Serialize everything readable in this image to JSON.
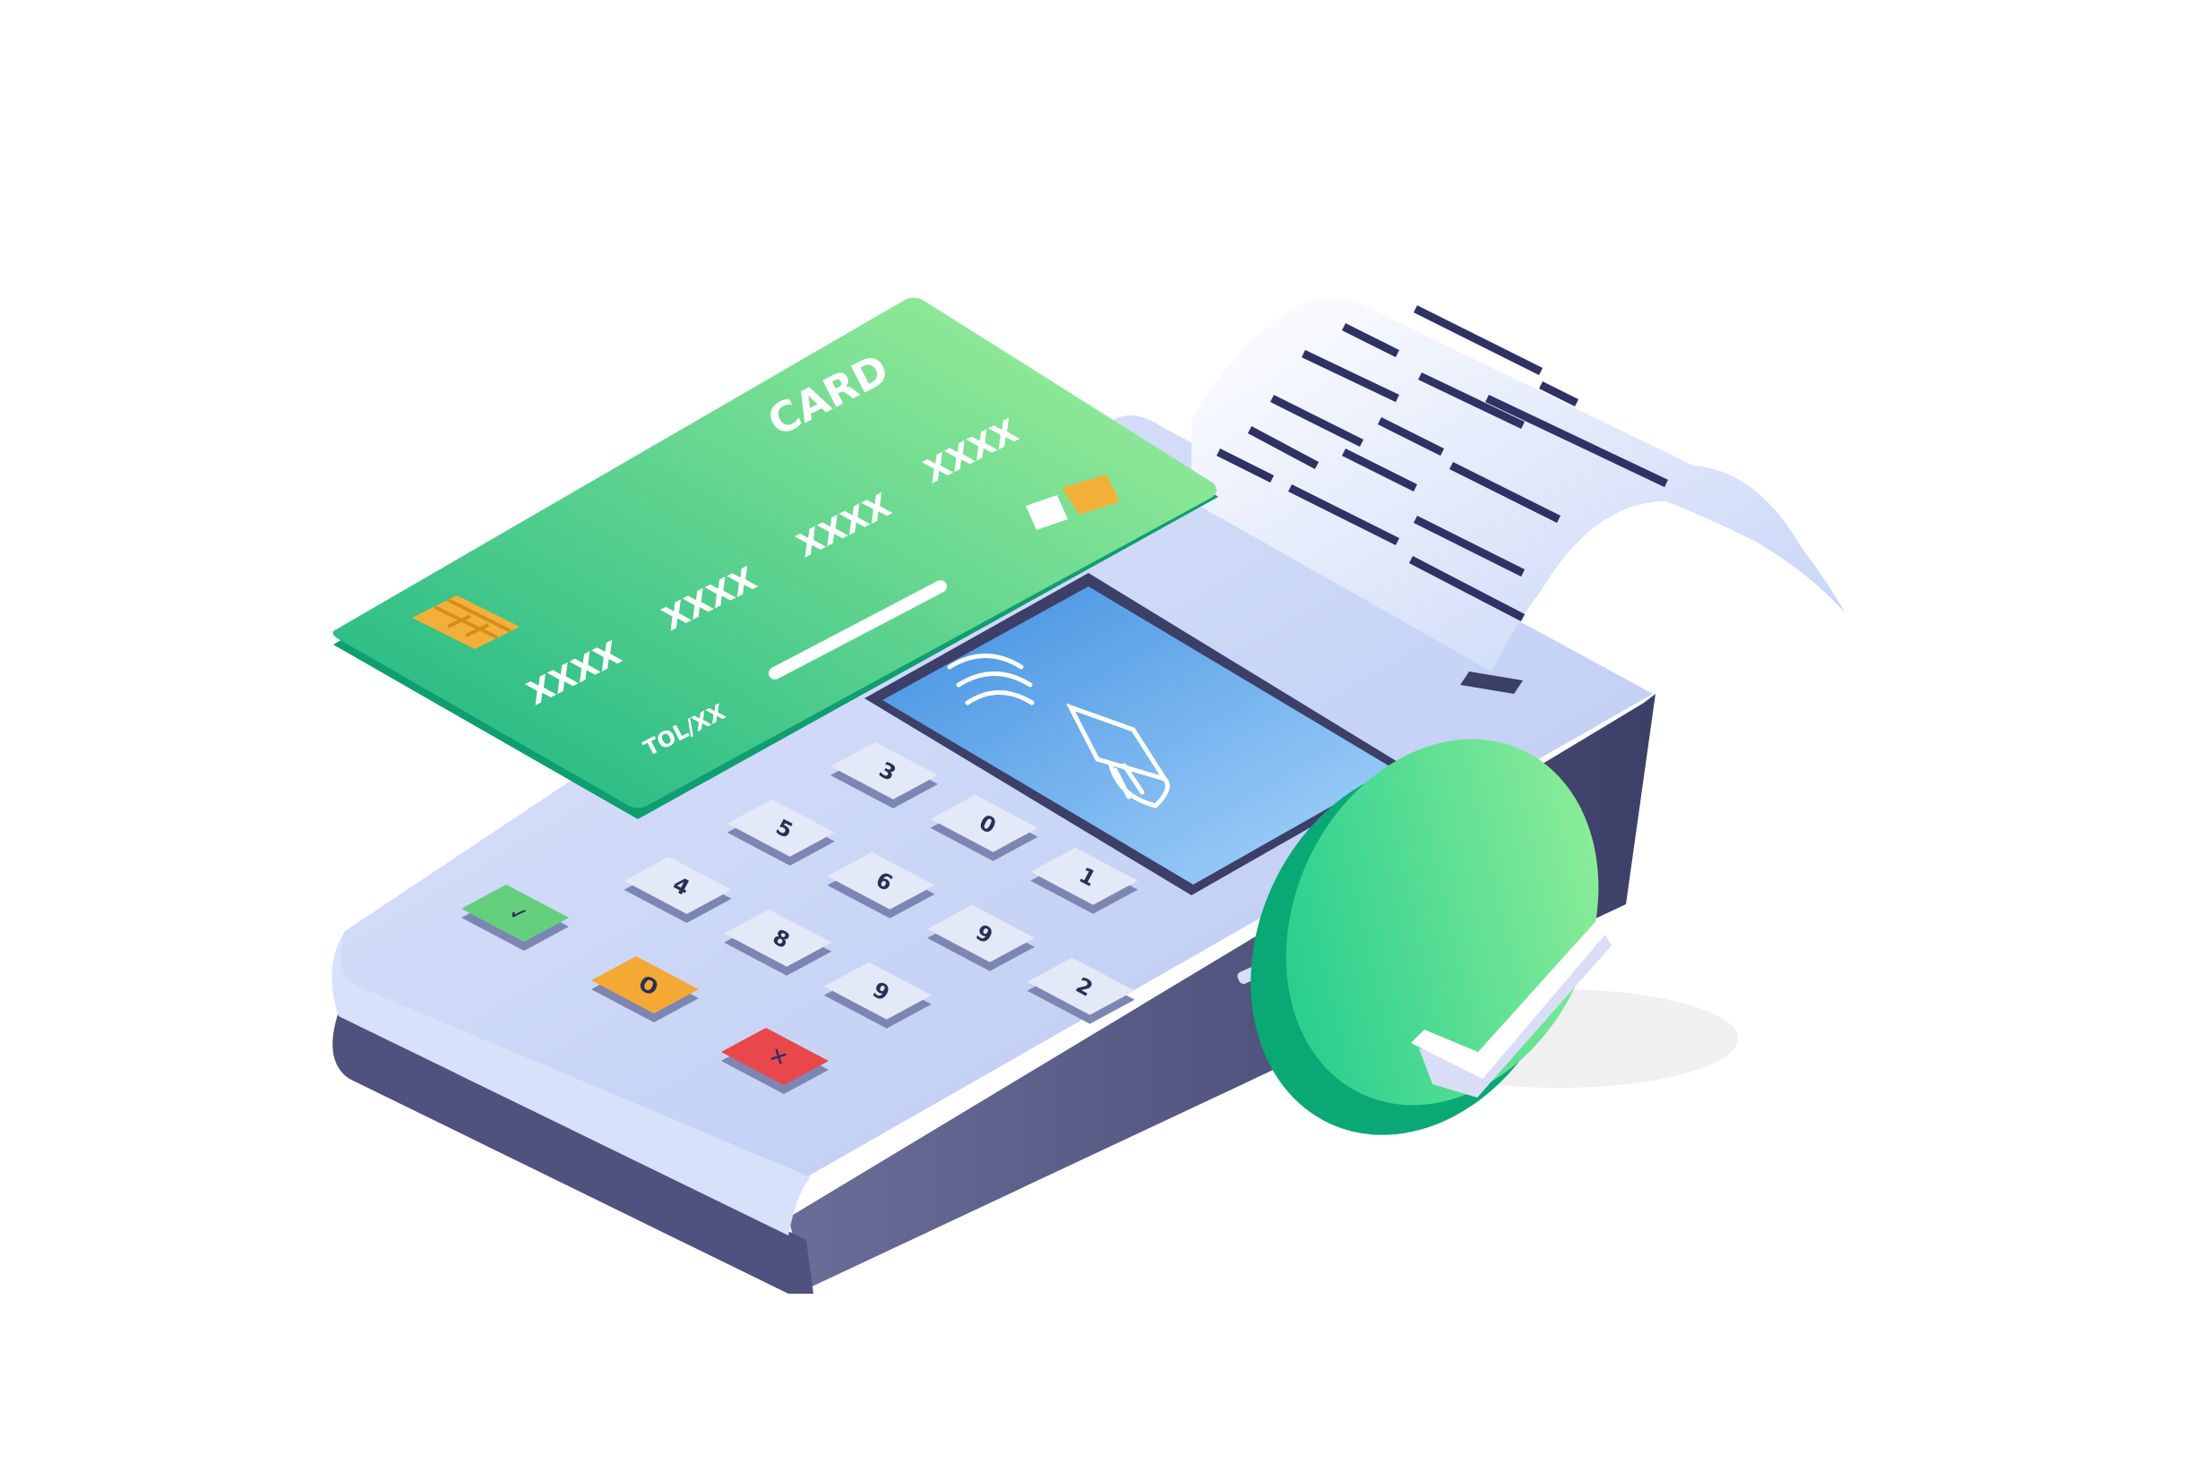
{
  "illustration": {
    "subject": "pos-terminal-card-payment"
  },
  "card": {
    "title": "CARD",
    "number_groups": [
      "XXXX",
      "XXXX",
      "XXXX",
      "XXXX"
    ],
    "small_text": "TOL/XX",
    "color_top": "#8fea96",
    "color_bottom": "#1fbe84",
    "chip_color": "#f2b03a"
  },
  "keypad": {
    "keys": [
      "4",
      "5",
      "3",
      "8",
      "6",
      "0",
      "9",
      "9",
      "1",
      "2"
    ],
    "confirm_label": "✓",
    "clear_label": "O",
    "cancel_label": "✕",
    "colors": {
      "confirm": "#63cf7d",
      "clear": "#f4a935",
      "cancel": "#e9474c",
      "key": "#e4e9f7"
    }
  },
  "screen": {
    "icon": "contactless-tap-icon",
    "color": "#6fb4f2"
  },
  "receipt": {
    "icon": "receipt-icon"
  },
  "status": {
    "icon": "check-icon",
    "color": "#2ed08a"
  },
  "device": {
    "body_color": "#c9d6f6",
    "side_color": "#4a4d78"
  }
}
